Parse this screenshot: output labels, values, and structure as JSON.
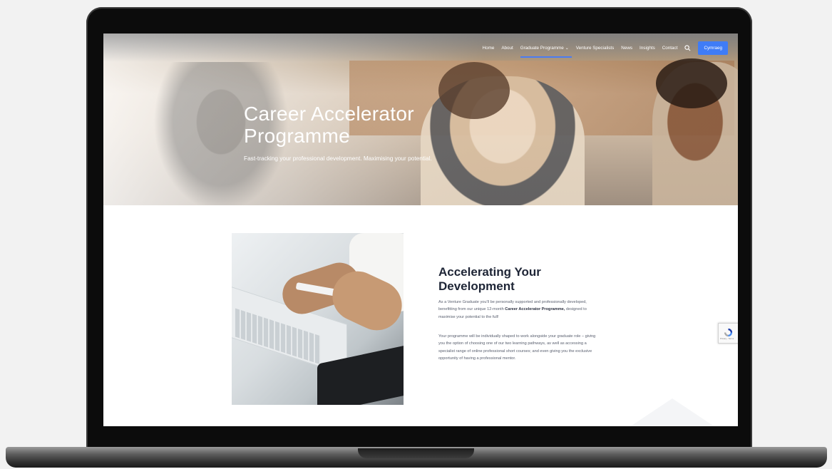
{
  "nav": {
    "items": [
      "Home",
      "About",
      "Graduate Programme",
      "Venture Specialists",
      "News",
      "Insights",
      "Contact"
    ],
    "active_index": 2,
    "caret": "⌄",
    "button": "Cymraeg"
  },
  "hero": {
    "title_line1": "Career Accelerator",
    "title_line2": "Programme",
    "subtitle": "Fast-tracking your professional development. Maximising your potential."
  },
  "content": {
    "heading_line1": "Accelerating Your",
    "heading_line2": "Development",
    "p1_a": "As a Venture Graduate you'll be personally supported and professionally developed, benefitting from our unique 12-month",
    "p1_bold": "Career Accelerator Programme,",
    "p1_b": "designed to maximise your potential to the full!",
    "p2": "Your programme will be individually shaped to work alongside your graduate role – giving you the option of choosing one of our two learning pathways, as well as accessing a specialist range of online professional short courses; and even giving you the exclusive opportunity of having a professional mentor."
  },
  "recaptcha": {
    "text": "Privacy - Terms"
  },
  "colors": {
    "accent": "#3f7cf6",
    "heading": "#1e2536",
    "body_text": "#5b6170"
  },
  "icons": {
    "search": "search-icon",
    "recaptcha": "recaptcha-icon"
  }
}
